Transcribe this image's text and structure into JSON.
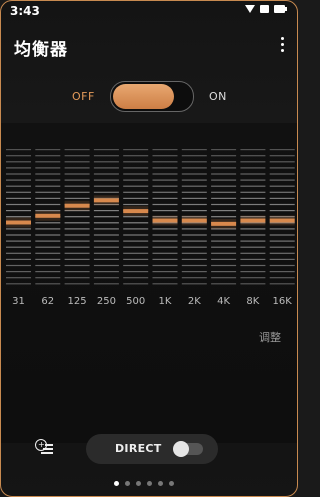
{
  "status_bar": {
    "time": "3:43"
  },
  "app": {
    "title": "均衡器"
  },
  "power": {
    "off_label": "OFF",
    "on_label": "ON",
    "state": "off",
    "accent": "#d8894e"
  },
  "equalizer": {
    "bands": [
      {
        "label": "31",
        "level": -0.05
      },
      {
        "label": "62",
        "level": 0.05
      },
      {
        "label": "125",
        "level": 0.2
      },
      {
        "label": "250",
        "level": 0.28
      },
      {
        "label": "500",
        "level": 0.12
      },
      {
        "label": "1K",
        "level": -0.02
      },
      {
        "label": "2K",
        "level": -0.02
      },
      {
        "label": "4K",
        "level": -0.07
      },
      {
        "label": "8K",
        "level": -0.02
      },
      {
        "label": "16K",
        "level": -0.02
      }
    ],
    "adjust_label": "调整"
  },
  "direct": {
    "label": "DIRECT",
    "enabled": false
  },
  "pagination": {
    "count": 6,
    "active": 0
  }
}
